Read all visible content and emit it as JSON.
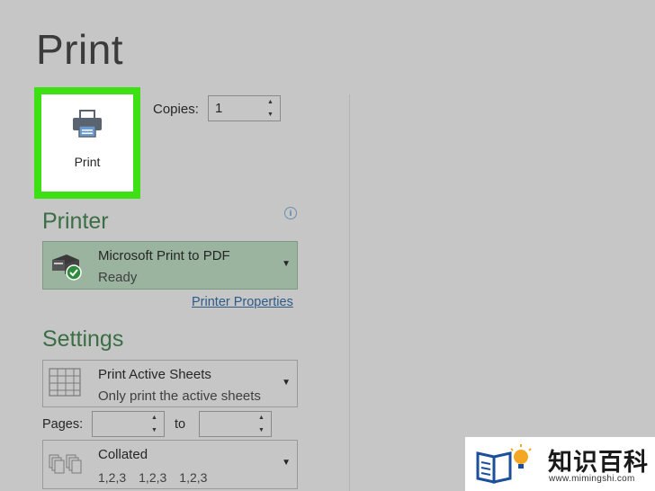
{
  "page": {
    "title": "Print"
  },
  "print_button": {
    "label": "Print"
  },
  "copies": {
    "label": "Copies:",
    "value": "1"
  },
  "printer": {
    "heading": "Printer",
    "name": "Microsoft Print to PDF",
    "status": "Ready",
    "properties_link": "Printer Properties",
    "info_icon": "i"
  },
  "settings": {
    "heading": "Settings",
    "scope": {
      "title": "Print Active Sheets",
      "subtitle": "Only print the active sheets"
    },
    "pages": {
      "label": "Pages:",
      "to_label": "to",
      "from": "",
      "to": ""
    },
    "collation": {
      "title": "Collated",
      "sequence": [
        "1,2,3",
        "1,2,3",
        "1,2,3"
      ]
    }
  },
  "watermark": {
    "text": "知识百科",
    "url": "www.mimingshi.com"
  },
  "colors": {
    "highlight": "#3de012",
    "heading_green": "#3b6e45",
    "printer_dropdown": "#9bb49f",
    "link": "#2e5a88"
  }
}
